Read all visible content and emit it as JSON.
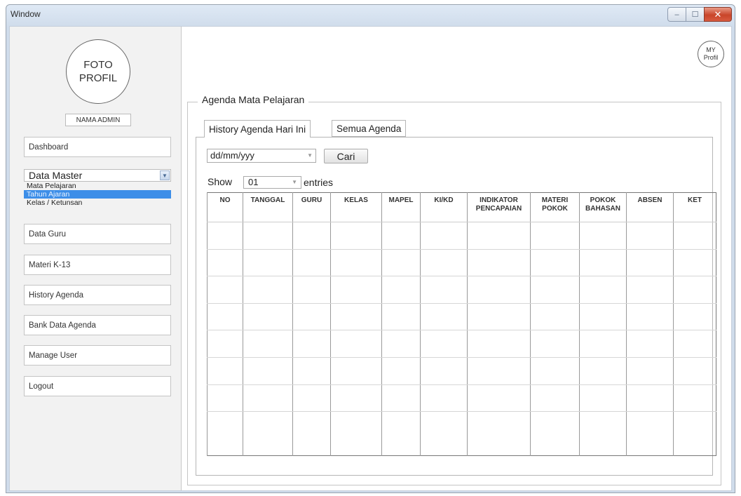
{
  "window": {
    "title": "Window",
    "controls": {
      "minimize": "–",
      "maximize": "☐",
      "close": "✕"
    }
  },
  "sidebar": {
    "avatar_line1": "FOTO",
    "avatar_line2": "PROFIL",
    "admin_name": "NAMA ADMIN",
    "dashboard": "Dashboard",
    "data_master": {
      "label": "Data Master",
      "options": [
        "Mata Pelajaran",
        "Tahun Ajaran",
        "Kelas / Ketunsan"
      ],
      "selected_index": 1
    },
    "items": [
      "Data Guru",
      "Materi K-13",
      "History Agenda",
      "Bank Data Agenda",
      "Manage User",
      "Logout"
    ]
  },
  "header": {
    "profil_line1": "MY",
    "profil_line2": "Profil"
  },
  "main": {
    "group_title": "Agenda Mata Pelajaran",
    "tabs": [
      {
        "label": "History Agenda Hari Ini",
        "active": true
      },
      {
        "label": "Semua Agenda",
        "active": false
      }
    ],
    "date_filter": {
      "value": "dd/mm/yyy"
    },
    "search_button": "Cari",
    "show_label": "Show",
    "entries_value": "01",
    "entries_label": "entries",
    "table": {
      "columns": [
        "NO",
        "TANGGAL",
        "GURU",
        "KELAS",
        "MAPEL",
        "KI/KD",
        "INDIKATOR PENCAPAIAN",
        "MATERI POKOK",
        "POKOK BAHASAN",
        "ABSEN",
        "KET"
      ],
      "rows": [
        [
          "",
          "",
          "",
          "",
          "",
          "",
          "",
          "",
          "",
          "",
          ""
        ],
        [
          "",
          "",
          "",
          "",
          "",
          "",
          "",
          "",
          "",
          "",
          ""
        ],
        [
          "",
          "",
          "",
          "",
          "",
          "",
          "",
          "",
          "",
          "",
          ""
        ],
        [
          "",
          "",
          "",
          "",
          "",
          "",
          "",
          "",
          "",
          "",
          ""
        ],
        [
          "",
          "",
          "",
          "",
          "",
          "",
          "",
          "",
          "",
          "",
          ""
        ],
        [
          "",
          "",
          "",
          "",
          "",
          "",
          "",
          "",
          "",
          "",
          ""
        ],
        [
          "",
          "",
          "",
          "",
          "",
          "",
          "",
          "",
          "",
          "",
          ""
        ],
        [
          "",
          "",
          "",
          "",
          "",
          "",
          "",
          "",
          "",
          "",
          ""
        ]
      ]
    }
  }
}
